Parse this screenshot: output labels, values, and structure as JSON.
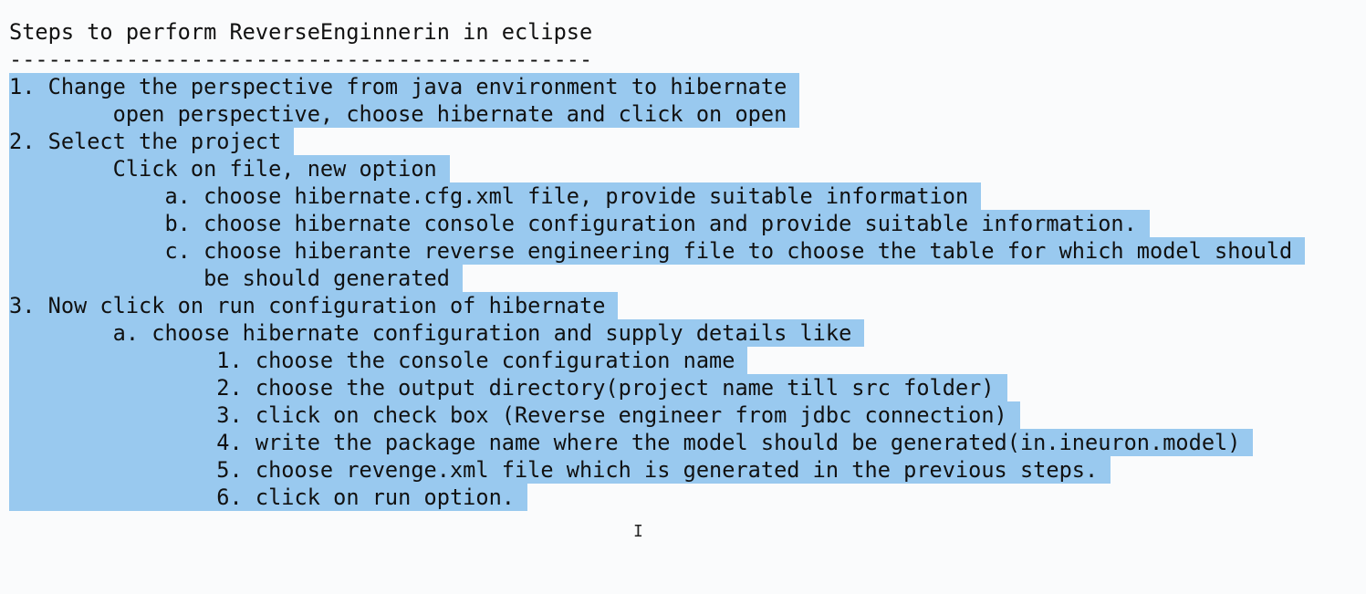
{
  "colors": {
    "background": "#fafbfc",
    "selection": "#99c9ef",
    "text": "#111111"
  },
  "document": {
    "title": "Steps to perform ReverseEnginnerin in eclipse",
    "separator": "---------------------------------------------",
    "lines": [
      "1. Change the perspective from java environment to hibernate",
      "        open perspective, choose hibernate and click on open",
      "2. Select the project",
      "        Click on file, new option",
      "            a. choose hibernate.cfg.xml file, provide suitable information",
      "            b. choose hibernate console configuration and provide suitable information.",
      "            c. choose hiberante reverse engineering file to choose the table for which model should",
      "               be should generated",
      "3. Now click on run configuration of hibernate",
      "        a. choose hibernate configuration and supply details like",
      "                1. choose the console configuration name",
      "                2. choose the output directory(project name till src folder)",
      "                3. click on check box (Reverse engineer from jdbc connection)",
      "                4. write the package name where the model should be generated(in.ineuron.model)",
      "                5. choose revenge.xml file which is generated in the previous steps.",
      "                6. click on run option."
    ]
  },
  "cursor": {
    "icon": "text-cursor-icon",
    "glyph": "I"
  }
}
